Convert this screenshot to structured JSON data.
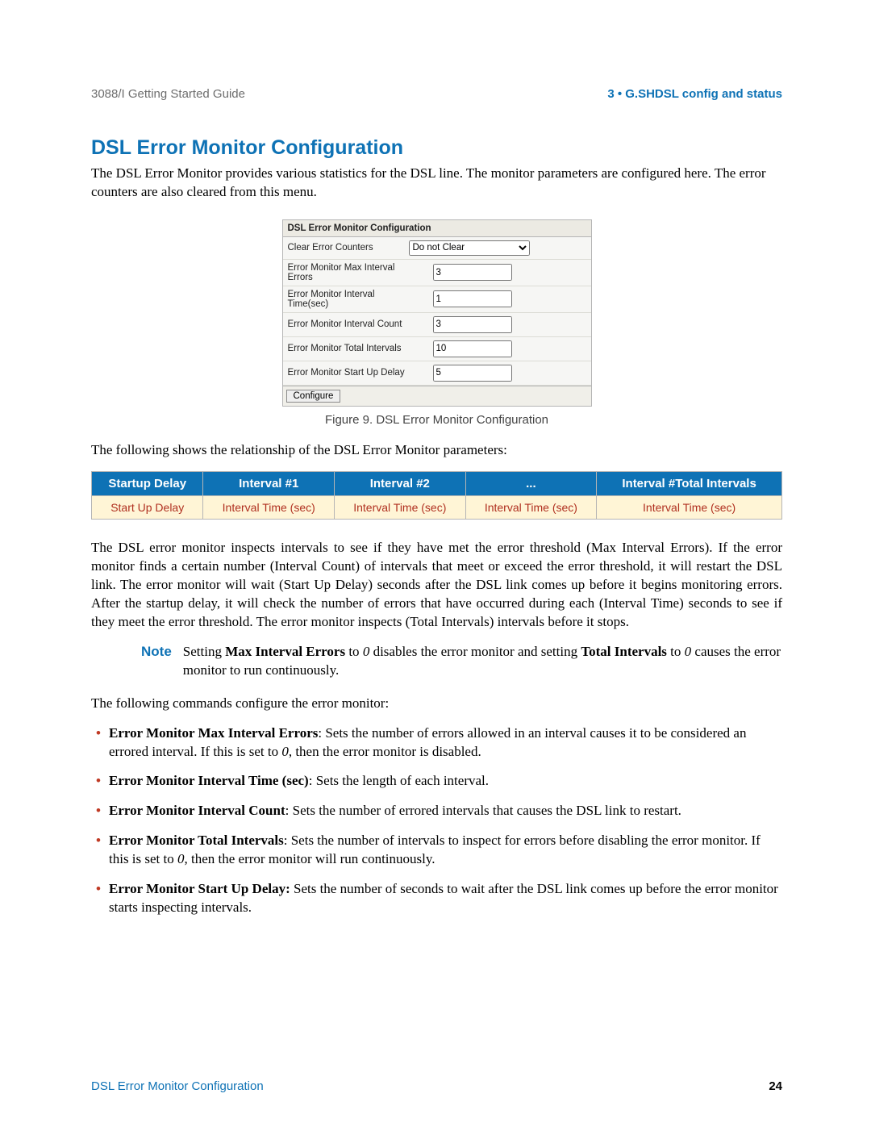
{
  "header": {
    "left": "3088/I Getting Started Guide",
    "right": "3 • G.SHDSL config and status"
  },
  "section_title": "DSL Error Monitor Configuration",
  "intro_paragraph": "The DSL Error Monitor provides various statistics for the DSL line. The monitor parameters are configured here. The error counters are also cleared from this menu.",
  "config_panel": {
    "title": "DSL Error Monitor Configuration",
    "rows": [
      {
        "label": "Clear Error Counters",
        "type": "select",
        "value": "Do not Clear"
      },
      {
        "label": "Error Monitor Max Interval Errors",
        "type": "input",
        "value": "3"
      },
      {
        "label": "Error Monitor Interval Time(sec)",
        "type": "input",
        "value": "1"
      },
      {
        "label": "Error Monitor Interval Count",
        "type": "input",
        "value": "3"
      },
      {
        "label": "Error Monitor Total Intervals",
        "type": "input",
        "value": "10"
      },
      {
        "label": "Error Monitor Start Up Delay",
        "type": "input",
        "value": "5"
      }
    ],
    "button": "Configure"
  },
  "figure_caption": "Figure 9. DSL Error Monitor Configuration",
  "relation_intro": "The following shows the relationship of the DSL Error Monitor parameters:",
  "interval_table": {
    "headers": [
      "Startup Delay",
      "Interval #1",
      "Interval #2",
      "...",
      "Interval #Total Intervals"
    ],
    "row": [
      "Start Up Delay",
      "Interval Time (sec)",
      "Interval Time (sec)",
      "Interval Time (sec)",
      "Interval Time (sec)"
    ]
  },
  "explanation_paragraph": "The DSL error monitor inspects intervals to see if they have met the error threshold (Max Interval Errors). If the error monitor finds a certain number (Interval Count) of intervals that meet or exceed the error threshold, it will restart the DSL link. The error monitor will wait (Start Up Delay) seconds after the DSL link comes up before it begins monitoring errors. After the startup delay, it will check the number of errors that have occurred during each (Interval Time) seconds to see if they meet the error threshold. The error monitor inspects (Total Intervals) intervals before it stops.",
  "note": {
    "label": "Note",
    "text_prefix": "Setting ",
    "bold1": "Max Interval Errors",
    "text_mid1": " to ",
    "italic1": "0",
    "text_mid2": " disables the error monitor and setting ",
    "bold2": "Total Intervals",
    "text_mid3": " to ",
    "italic2": "0",
    "text_suffix": " causes the error monitor to run continuously."
  },
  "commands_intro": "The following commands configure the error monitor:",
  "bullets": [
    {
      "bold": "Error Monitor Max Interval Errors",
      "rest_a": ": Sets the number of errors allowed in an interval causes it to be considered an errored interval. If this is set to ",
      "italic": "0",
      "rest_b": ", then the error monitor is disabled."
    },
    {
      "bold": "Error Monitor Interval Time (sec)",
      "rest_a": ": Sets the length of each interval.",
      "italic": "",
      "rest_b": ""
    },
    {
      "bold": "Error Monitor Interval Count",
      "rest_a": ": Sets the number of errored intervals that causes the DSL link to restart.",
      "italic": "",
      "rest_b": ""
    },
    {
      "bold": "Error Monitor Total Intervals",
      "rest_a": ": Sets the number of intervals to inspect for errors before disabling the error monitor. If this is set to ",
      "italic": "0",
      "rest_b": ", then the error monitor will run continuously."
    },
    {
      "bold": "Error Monitor Start Up Delay:",
      "rest_a": " Sets the number of seconds to wait after the DSL link comes up before the error monitor starts inspecting intervals.",
      "italic": "",
      "rest_b": ""
    }
  ],
  "footer": {
    "left": "DSL Error Monitor Configuration",
    "right": "24"
  }
}
